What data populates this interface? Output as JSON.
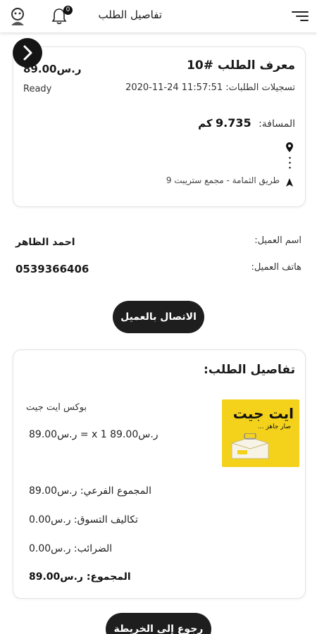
{
  "header": {
    "title": "تفاصيل الطلب",
    "notification_count": "0"
  },
  "order": {
    "id_label": "معرف الطلب #10",
    "price": "ر.س89.00",
    "status": "Ready",
    "registration_label": "تسجيلات الطلبات:",
    "registration_datetime": "2020-11-24 11:57:51",
    "distance_label": "المسافة:",
    "distance_value": "9.735",
    "distance_unit": "كم",
    "from_address": "",
    "to_address": "طريق الثمامة - مجمع ستريبت 9"
  },
  "customer": {
    "name_label": "اسم العميل:",
    "name_value": "احمد الظاهر",
    "phone_label": "هاتف العميل:",
    "phone_value": "0539366406",
    "call_button": "الاتصال بالعميل"
  },
  "details": {
    "heading": "تفاصيل الطلب:",
    "item_name": "بوكس ايت جيت",
    "item_line": "ر.س89.00 x 1 = ر.س89.00",
    "image_text_main": "ايت جيت",
    "image_text_sub": "صار جاهز ...",
    "subtotal": "المجموع الفرعي: ر.س89.00",
    "shipping": "تكاليف التسوق: ر.س0.00",
    "tax": "الضرائب: ر.س0.00",
    "total": "المجموع: ر.س89.00"
  },
  "footer": {
    "map_button": "رجوع إلى الخريطة"
  },
  "colors": {
    "accent_dark": "#1e1e1e",
    "product_yellow": "#f4d21c"
  }
}
